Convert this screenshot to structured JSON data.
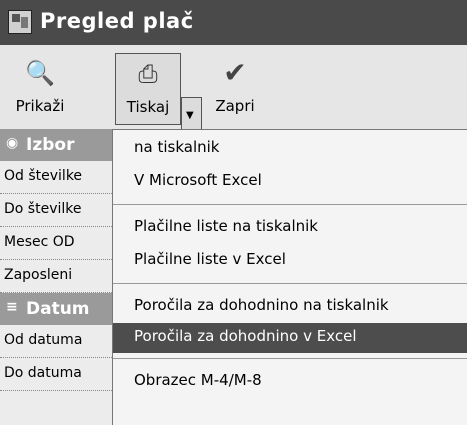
{
  "window": {
    "title": "Pregled plač"
  },
  "toolbar": {
    "buttons": [
      {
        "label": "Prikaži",
        "icon": "magnifier-page-icon"
      },
      {
        "label": "Tiskaj",
        "icon": "printer-icon"
      },
      {
        "label": "Zapri",
        "icon": "checkmark-icon"
      }
    ],
    "dropdown_icon": "▼"
  },
  "panel": {
    "headers": [
      {
        "label": "Izbor",
        "icon": "collapse-icon"
      },
      {
        "label": "Datum",
        "icon": "expand-icon"
      }
    ],
    "rows": [
      "Od številke",
      "Do številke",
      "Mesec OD",
      "Zaposleni",
      "Od datuma",
      "Do datuma"
    ]
  },
  "menu": {
    "items": [
      "na tiskalnik",
      "V Microsoft Excel",
      "Plačilne liste na tiskalnik",
      "Plačilne liste v Excel",
      "Poročila za dohodnino na tiskalnik",
      "Poročila za dohodnino v Excel",
      "Obrazec M-4/M-8"
    ],
    "highlighted_index": 5,
    "highlight_color": "#4d4d4d"
  }
}
